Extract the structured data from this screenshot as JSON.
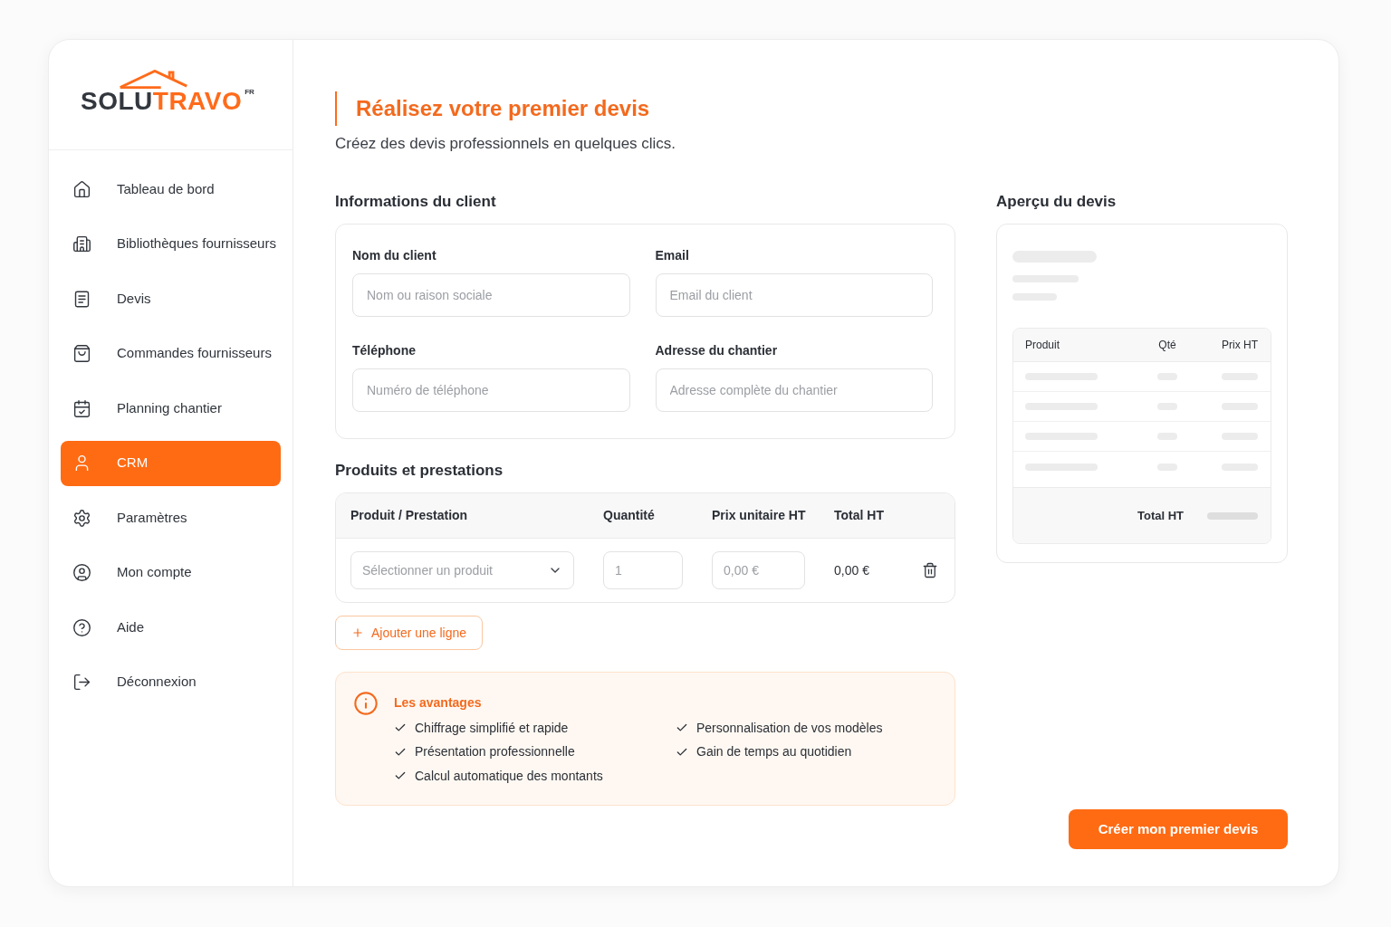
{
  "sidebar": {
    "logo": {
      "text": "SOLU",
      "accent": "TRAVO",
      "superscript": "FR"
    },
    "items": [
      {
        "label": "Tableau de bord",
        "selected": false
      },
      {
        "label": "Bibliothèques fournisseurs",
        "selected": false
      },
      {
        "label": "Devis",
        "selected": false
      },
      {
        "label": "Commandes fournisseurs",
        "selected": false
      },
      {
        "label": "Planning chantier",
        "selected": false
      },
      {
        "label": "CRM",
        "selected": true
      },
      {
        "label": "Paramètres",
        "selected": false
      },
      {
        "label": "Mon compte",
        "selected": false
      },
      {
        "label": "Aide",
        "selected": false
      },
      {
        "label": "Déconnexion",
        "selected": false
      }
    ]
  },
  "header": {
    "title": "Réalisez votre premier devis",
    "subtitle": "Créez des devis professionnels en quelques clics."
  },
  "client_info": {
    "title": "Informations du client",
    "fields": [
      {
        "label": "Nom du client",
        "placeholder": "Nom ou raison sociale"
      },
      {
        "label": "Email",
        "placeholder": "Email du client"
      },
      {
        "label": "Téléphone",
        "placeholder": "Numéro de téléphone"
      },
      {
        "label": "Adresse du chantier",
        "placeholder": "Adresse complète du chantier"
      }
    ]
  },
  "products": {
    "title": "Produits et prestations",
    "columns": [
      "Produit / Prestation",
      "Quantité",
      "Prix unitaire HT",
      "Total HT"
    ],
    "rows": [
      {
        "product": {
          "placeholder": "Sélectionner un produit"
        },
        "quantity": {
          "placeholder": "1"
        },
        "unit_price": {
          "placeholder": "0,00 €"
        },
        "total": "0,00 €"
      }
    ],
    "add_button": "Ajouter une ligne"
  },
  "advantages": {
    "title": "Les avantages",
    "items": [
      "Chiffrage simplifié et rapide",
      "Personnalisation de vos modèles",
      "Présentation professionnelle",
      "Gain de temps au quotidien",
      "Calcul automatique des montants"
    ]
  },
  "preview": {
    "title": "Aperçu du devis",
    "columns": [
      "Produit",
      "Qté",
      "Prix HT"
    ],
    "total_label": "Total HT"
  },
  "create_button": "Créer mon premier devis"
}
